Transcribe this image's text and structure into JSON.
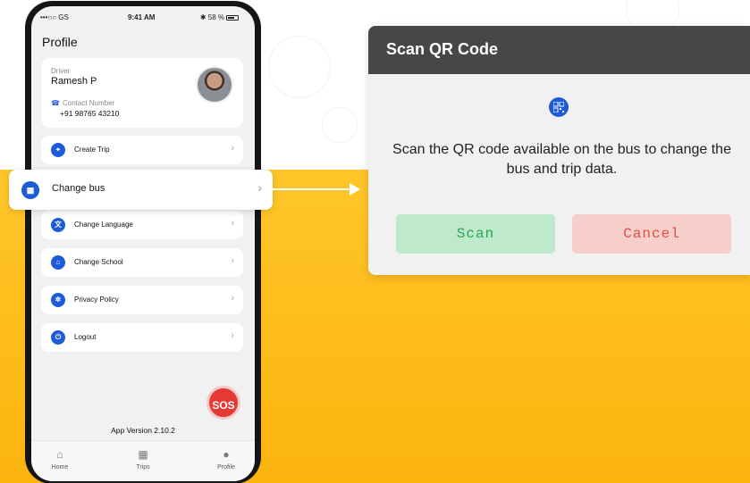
{
  "status_bar": {
    "carrier": "•••○○ GS",
    "time": "9:41 AM",
    "battery": "58 %"
  },
  "profile": {
    "title": "Profile",
    "driver_label": "Driver",
    "driver_name": "Ramesh P",
    "contact_label": "Contact Number",
    "contact_value": "+91 98765 43210"
  },
  "menu": {
    "items": [
      {
        "label": "Create Trip",
        "icon": "location-pin-icon"
      },
      {
        "label": "Change Language",
        "icon": "translate-icon"
      },
      {
        "label": "Change School",
        "icon": "school-icon"
      },
      {
        "label": "Privacy Policy",
        "icon": "privacy-icon"
      },
      {
        "label": "Logout",
        "icon": "power-icon"
      }
    ],
    "chevron": "›"
  },
  "popout": {
    "label": "Change bus",
    "icon": "qr-code-icon",
    "chevron": "›"
  },
  "sos_label": "SOS",
  "app_version": "App Version 2.10.2",
  "tabs": [
    {
      "label": "Home",
      "icon": "home-icon"
    },
    {
      "label": "Trips",
      "icon": "calendar-icon"
    },
    {
      "label": "Profile",
      "icon": "user-icon"
    }
  ],
  "dialog": {
    "title": "Scan QR Code",
    "message": "Scan the QR code available on the bus to change the bus and trip data.",
    "scan_label": "Scan",
    "cancel_label": "Cancel"
  },
  "colors": {
    "accent_blue": "#1e5bd8",
    "background_yellow": "#fcb40d",
    "sos_red": "#e53935",
    "scan_green": "#25a851",
    "cancel_red": "#e04e43",
    "dialog_header": "#474747"
  }
}
